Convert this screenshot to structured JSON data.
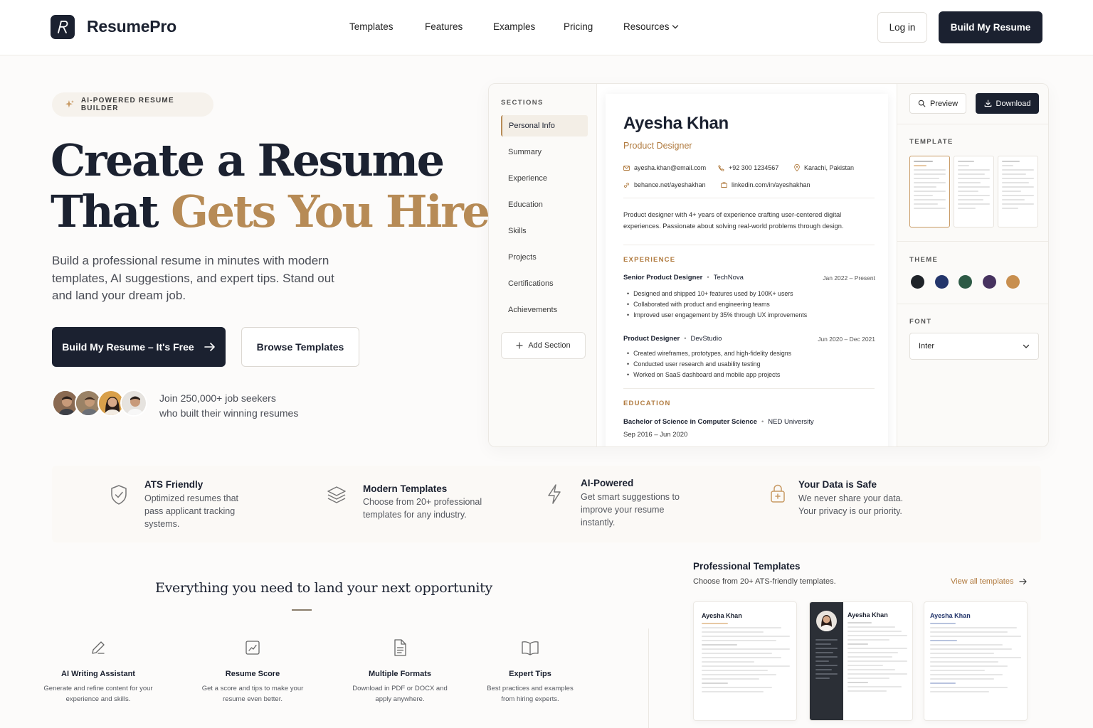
{
  "header": {
    "logo_letter": "R",
    "brand": "ResumePro",
    "nav": [
      "Templates",
      "Features",
      "Examples",
      "Pricing",
      "Resources"
    ],
    "login": "Log in",
    "cta": "Build My Resume"
  },
  "hero": {
    "badge": "AI-POWERED RESUME BUILDER",
    "title_line1": "Create a Resume",
    "title_line2_a": "That ",
    "title_line2_b": "Gets You Hired",
    "subtitle": "Build a professional resume in minutes with modern templates, AI suggestions, and expert tips. Stand out and land your dream job.",
    "primary_cta": "Build My Resume – It's Free",
    "secondary_cta": "Browse Templates",
    "join_line1": "Join 250,000+ job seekers",
    "join_line2": "who built their winning resumes"
  },
  "editor": {
    "sections_heading": "SECTIONS",
    "sections": [
      "Personal Info",
      "Summary",
      "Experience",
      "Education",
      "Skills",
      "Projects",
      "Certifications",
      "Achievements"
    ],
    "add_section": "Add Section",
    "resume": {
      "name": "Ayesha Khan",
      "role": "Product Designer",
      "email": "ayesha.khan@email.com",
      "phone": "+92 300 1234567",
      "location": "Karachi, Pakistan",
      "behance": "behance.net/ayeshakhan",
      "linkedin": "linkedin.com/in/ayeshakhan",
      "summary": "Product designer with 4+ years of experience crafting user-centered digital experiences. Passionate about solving real-world problems through design.",
      "experience_heading": "EXPERIENCE",
      "jobs": [
        {
          "title": "Senior Product Designer",
          "company": "TechNova",
          "dates": "Jan 2022 – Present",
          "bullets": [
            "Designed and shipped 10+ features used by 100K+ users",
            "Collaborated with product and engineering teams",
            "Improved user engagement by 35% through UX improvements"
          ]
        },
        {
          "title": "Product Designer",
          "company": "DevStudio",
          "dates": "Jun 2020 – Dec 2021",
          "bullets": [
            "Created wireframes, prototypes, and high-fidelity designs",
            "Conducted user research and usability testing",
            "Worked on SaaS dashboard and mobile app projects"
          ]
        }
      ],
      "education_heading": "EDUCATION",
      "degree": "Bachelor of Science in Computer Science",
      "school": "NED University",
      "edu_dates": "Sep 2016 – Jun 2020"
    },
    "panel": {
      "preview": "Preview",
      "download": "Download",
      "template_heading": "TEMPLATE",
      "theme_heading": "THEME",
      "theme_colors": [
        "#1f2329",
        "#23356b",
        "#2d5a45",
        "#46325f",
        "#c88f4f"
      ],
      "font_heading": "FONT",
      "font_value": "Inter"
    }
  },
  "features": [
    {
      "title": "ATS Friendly",
      "desc": "Optimized resumes that pass applicant tracking systems.",
      "icon": "shield-check-icon"
    },
    {
      "title": "Modern Templates",
      "desc": "Choose from 20+ professional templates for any industry.",
      "icon": "layers-icon"
    },
    {
      "title": "AI-Powered",
      "desc": "Get smart suggestions to improve your resume instantly.",
      "icon": "lightning-icon"
    },
    {
      "title": "Your Data is Safe",
      "desc": "We never share your data. Your privacy is our priority.",
      "icon": "lock-icon"
    }
  ],
  "everything": {
    "heading": "Everything you need to land your next opportunity",
    "tools": [
      {
        "title": "AI Writing Assistant",
        "desc": "Generate and refine content for your experience and skills.",
        "icon": "pencil-icon"
      },
      {
        "title": "Resume Score",
        "desc": "Get a score and tips to make your resume even better.",
        "icon": "chart-icon"
      },
      {
        "title": "Multiple Formats",
        "desc": "Download in PDF or DOCX and apply anywhere.",
        "icon": "document-icon"
      },
      {
        "title": "Expert Tips",
        "desc": "Best practices and examples from hiring experts.",
        "icon": "book-icon"
      }
    ]
  },
  "pro_templates": {
    "title": "Professional Templates",
    "subtitle": "Choose from 20+ ATS-friendly templates.",
    "link": "View all templates",
    "cards": [
      {
        "name": "Ayesha Khan"
      },
      {
        "name": "Ayesha Khan"
      },
      {
        "name": "Ayesha Khan"
      }
    ]
  }
}
